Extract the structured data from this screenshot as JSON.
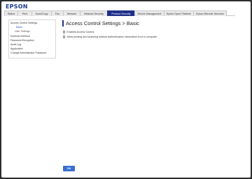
{
  "brand": {
    "logo_text": "EPSON"
  },
  "tabs": [
    {
      "label": "Status"
    },
    {
      "label": "Print"
    },
    {
      "label": "Scan/Copy"
    },
    {
      "label": "Fax"
    },
    {
      "label": "Network"
    },
    {
      "label": "Network Security"
    },
    {
      "label": "Product Security",
      "active": true
    },
    {
      "label": "Device Management"
    },
    {
      "label": "Epson Open Platform"
    },
    {
      "label": "Epson Remote Services"
    }
  ],
  "sidebar": {
    "items": [
      {
        "label": "Access Control Settings"
      },
      {
        "label": "Basic",
        "current": true
      },
      {
        "label": "User Settings"
      },
      {
        "label": "External Interface"
      },
      {
        "label": "Password Encryption"
      },
      {
        "label": "Audit Log"
      },
      {
        "label": "Application"
      },
      {
        "label": "Change Administrator Password"
      }
    ]
  },
  "main": {
    "title": "Access Control Settings > Basic",
    "options": [
      {
        "label": "Enables Access Control",
        "checked": false
      },
      {
        "label": "Allow printing and scanning without authentication information from a computer",
        "checked": false
      }
    ]
  },
  "buttons": {
    "ok_label": "OK"
  },
  "colors": {
    "brand": "#1d3b8e",
    "active_tab": "#1e2f8a",
    "ok_button": "#3a6fd0",
    "frame_bg": "#2d2d2d"
  }
}
